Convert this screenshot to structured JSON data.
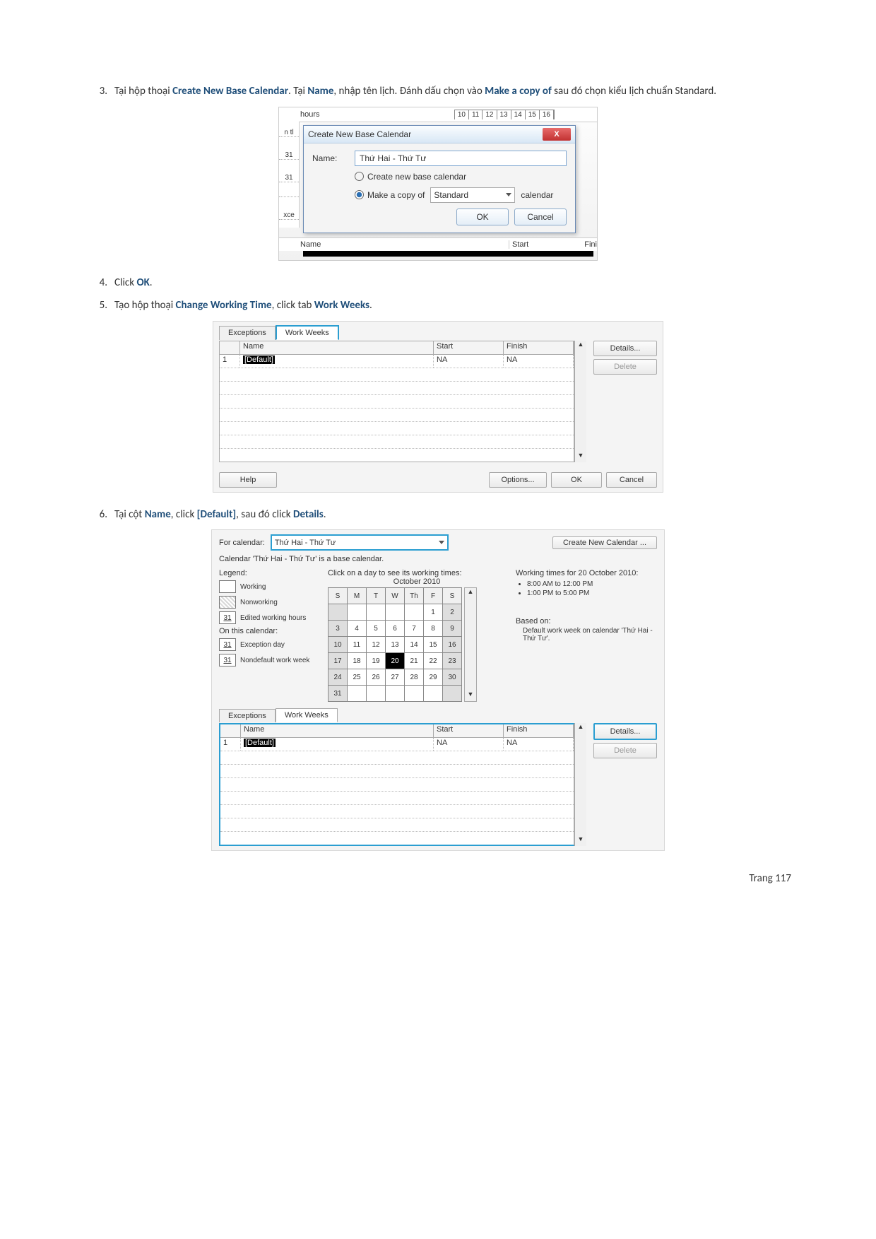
{
  "marker": "",
  "steps": {
    "s3": {
      "num": "3.",
      "t1": "Tại hộp thoại ",
      "b1": "Create New Base Calendar",
      "t2": ". Tại ",
      "b2": "Name",
      "t3": ", nhập tên lịch. Đánh dấu chọn vào ",
      "b3": "Make a copy of",
      "t4": " sau đó chọn kiểu lịch chuẩn Standard."
    },
    "s4": {
      "num": "4.",
      "t1": "Click ",
      "b1": "OK",
      "t2": "."
    },
    "s5": {
      "num": "5.",
      "t1": "Tạo hộp thoại ",
      "b1": "Change Working Time",
      "t2": ", click tab ",
      "b2": "Work Weeks",
      "t3": "."
    },
    "s6": {
      "num": "6.",
      "t1": "Tại cột ",
      "b1": "Name",
      "t2": ", click ",
      "b2": "[Default]",
      "t3": ", sau đó click ",
      "b3": "Details",
      "t4": "."
    }
  },
  "fig1": {
    "topbar_hours": "hours",
    "nums": [
      "10",
      "11",
      "12",
      "13",
      "14",
      "15",
      "16"
    ],
    "left": [
      "n tl",
      "31",
      "31",
      "",
      "xce"
    ],
    "title": "Create New Base Calendar",
    "close": "X",
    "name_label": "Name:",
    "name_value": "Thứ Hai - Thứ Tư",
    "radio_new_label": "Create new base calendar",
    "radio_copy_label": "Make a copy of",
    "copy_value": "Standard",
    "calendar_word": "calendar",
    "ok": "OK",
    "cancel": "Cancel",
    "bottom_name": "Name",
    "bottom_start": "Start",
    "bottom_fin": "Fini"
  },
  "fig2": {
    "tab_exceptions": "Exceptions",
    "tab_workweeks": "Work Weeks",
    "col_blank": "",
    "col_name": "Name",
    "col_start": "Start",
    "col_finish": "Finish",
    "row_num": "1",
    "row_name": "[Default]",
    "row_start": "NA",
    "row_finish": "NA",
    "details": "Details...",
    "delete": "Delete",
    "help": "Help",
    "options": "Options...",
    "ok": "OK",
    "cancel": "Cancel"
  },
  "fig3": {
    "for_calendar": "For calendar:",
    "cal_name": "Thứ Hai - Thứ Tư",
    "create_new": "Create New Calendar ...",
    "base_cal_text": "Calendar 'Thứ Hai - Thứ Tư' is a base calendar.",
    "legend_label": "Legend:",
    "leg_working": "Working",
    "leg_nonworking": "Nonworking",
    "leg_edited": "Edited working hours",
    "leg_31": "31",
    "on_this_cal": "On this calendar:",
    "leg_exception": "Exception day",
    "leg_nondefault": "Nondefault work week",
    "click_day": "Click on a day to see its working times:",
    "month": "October 2010",
    "day_headers": [
      "S",
      "M",
      "T",
      "W",
      "Th",
      "F",
      "S"
    ],
    "grid": [
      [
        "",
        "",
        "",
        "",
        "",
        "1",
        "2"
      ],
      [
        "3",
        "4",
        "5",
        "6",
        "7",
        "8",
        "9"
      ],
      [
        "10",
        "11",
        "12",
        "13",
        "14",
        "15",
        "16"
      ],
      [
        "17",
        "18",
        "19",
        "20",
        "21",
        "22",
        "23"
      ],
      [
        "24",
        "25",
        "26",
        "27",
        "28",
        "29",
        "30"
      ],
      [
        "31",
        "",
        "",
        "",
        "",
        "",
        ""
      ]
    ],
    "today": "20",
    "working_times_label": "Working times for 20 October 2010:",
    "wt_morning": "8:00 AM to 12:00 PM",
    "wt_afternoon": "1:00 PM to 5:00 PM",
    "based_on": "Based on:",
    "based_on_txt": "Default work week on calendar 'Thứ Hai - Thứ Tư'.",
    "tab_exceptions": "Exceptions",
    "tab_workweeks": "Work Weeks",
    "col_name": "Name",
    "col_start": "Start",
    "col_finish": "Finish",
    "row_num": "1",
    "row_name": "[Default]",
    "row_start": "NA",
    "row_finish": "NA",
    "details": "Details...",
    "delete": "Delete"
  },
  "footer": "Trang 117"
}
